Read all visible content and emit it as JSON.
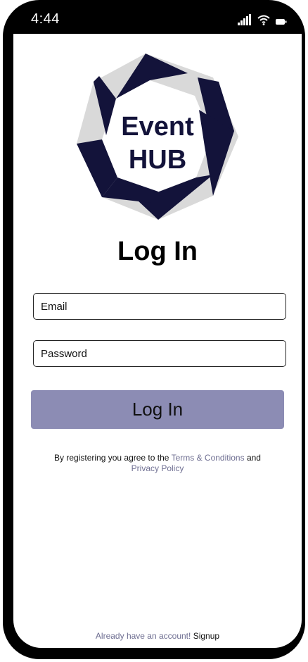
{
  "status_bar": {
    "time": "4:44",
    "icons": [
      "cellular-signal-icon",
      "wifi-icon",
      "battery-icon"
    ]
  },
  "logo": {
    "line1": "Event",
    "line2": "HUB",
    "colors": {
      "dark": "#13133a",
      "light": "#d9d9d9"
    }
  },
  "page_title": "Log In",
  "form": {
    "email_placeholder": "Email",
    "password_placeholder": "Password",
    "submit_label": "Log In"
  },
  "terms": {
    "prefix": "By registering you agree to the ",
    "terms_link": "Terms & Conditions",
    "middle": " and",
    "privacy_link": "Privacy Policy"
  },
  "footer": {
    "prompt": "Already have an account! ",
    "signup_link": "Signup"
  },
  "colors": {
    "accent_button": "#8c8cb4",
    "link": "#6f6f92",
    "frame": "#000000"
  }
}
